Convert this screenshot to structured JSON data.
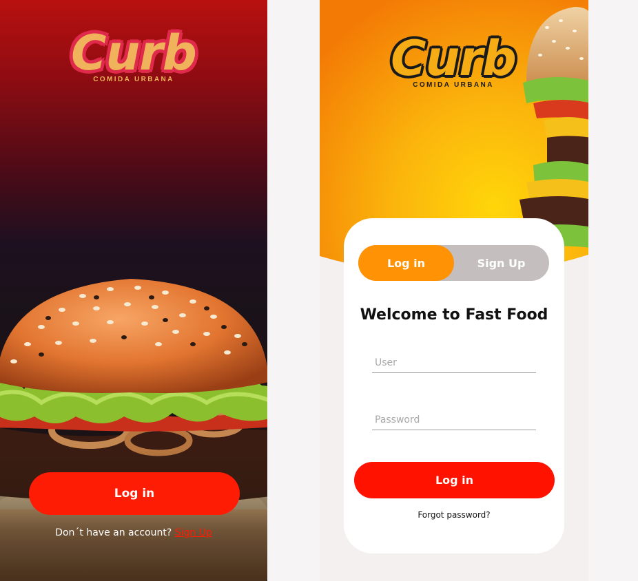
{
  "left_screen": {
    "logo": {
      "wordmark": "Curb",
      "tagline": "COMIDA URBANA"
    },
    "login_button": "Log in",
    "signup_prompt": "Don´t have an account?",
    "signup_link": "Sign Up"
  },
  "right_screen": {
    "logo": {
      "wordmark": "Curb",
      "tagline": "COMIDA URBANA"
    },
    "tabs": {
      "login": "Log in",
      "signup": "Sign Up",
      "active": "login"
    },
    "welcome_title": "Welcome to Fast Food",
    "user_placeholder": "User",
    "password_placeholder": "Password",
    "login_button": "Log in",
    "forgot_password": "Forgot password?"
  },
  "colors": {
    "primary_red": "#ff1c05",
    "accent_orange": "#ff9205",
    "toggle_inactive": "#c5bebe",
    "logo_yellow": "#f0b35b",
    "logo_outline_pink": "#e02a4c"
  }
}
